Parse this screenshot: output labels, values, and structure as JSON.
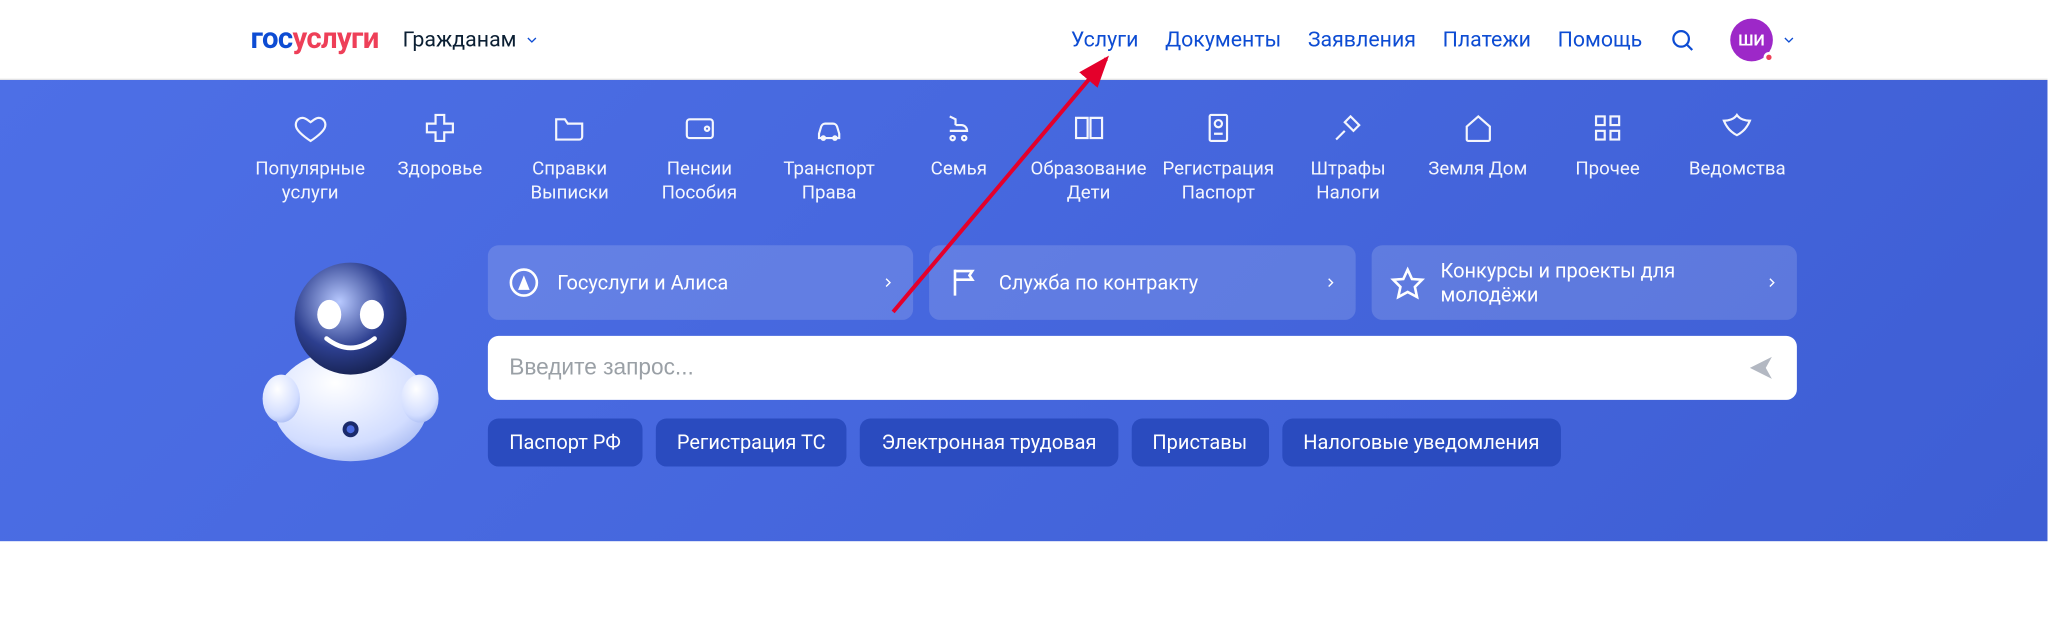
{
  "logo": {
    "part1": "гос",
    "part2": "услуги"
  },
  "audience_label": "Гражданам",
  "nav": {
    "services": "Услуги",
    "documents": "Документы",
    "applications": "Заявления",
    "payments": "Платежи",
    "help": "Помощь"
  },
  "avatar_initials": "ШИ",
  "categories": [
    {
      "label": "Популярные услуги"
    },
    {
      "label": "Здоровье"
    },
    {
      "label": "Справки Выписки"
    },
    {
      "label": "Пенсии Пособия"
    },
    {
      "label": "Транспорт Права"
    },
    {
      "label": "Семья"
    },
    {
      "label": "Образование Дети"
    },
    {
      "label": "Регистрация Паспорт"
    },
    {
      "label": "Штрафы Налоги"
    },
    {
      "label": "Земля Дом"
    },
    {
      "label": "Прочее"
    },
    {
      "label": "Ведомства"
    }
  ],
  "promos": [
    {
      "label": "Госуслуги и Алиса"
    },
    {
      "label": "Служба по контракту"
    },
    {
      "label": "Конкурсы и проекты для молодёжи"
    }
  ],
  "search": {
    "placeholder": "Введите запрос..."
  },
  "chips": [
    "Паспорт РФ",
    "Регистрация ТС",
    "Электронная трудовая",
    "Приставы",
    "Налоговые уведомления"
  ]
}
